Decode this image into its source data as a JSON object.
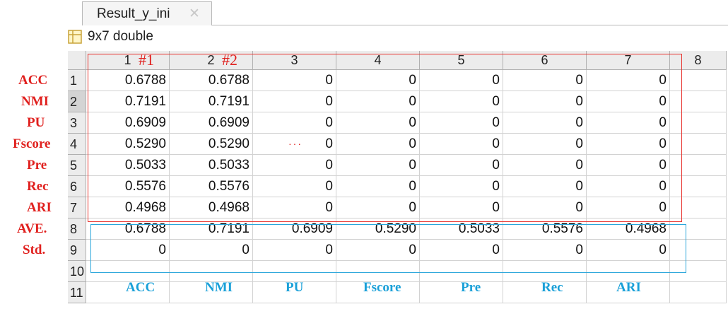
{
  "tab": {
    "label": "Result_y_ini",
    "close_glyph": "✕"
  },
  "variable_info": {
    "icon": "grid-icon",
    "text": "9x7 double"
  },
  "columns": [
    "1",
    "2",
    "3",
    "4",
    "5",
    "6",
    "7",
    "8"
  ],
  "rows": [
    {
      "num": "1",
      "values": [
        "0.6788",
        "0.6788",
        "0",
        "0",
        "0",
        "0",
        "0",
        ""
      ]
    },
    {
      "num": "2",
      "values": [
        "0.7191",
        "0.7191",
        "0",
        "0",
        "0",
        "0",
        "0",
        ""
      ]
    },
    {
      "num": "3",
      "values": [
        "0.6909",
        "0.6909",
        "0",
        "0",
        "0",
        "0",
        "0",
        ""
      ]
    },
    {
      "num": "4",
      "values": [
        "0.5290",
        "0.5290",
        "0",
        "0",
        "0",
        "0",
        "0",
        ""
      ]
    },
    {
      "num": "5",
      "values": [
        "0.5033",
        "0.5033",
        "0",
        "0",
        "0",
        "0",
        "0",
        ""
      ]
    },
    {
      "num": "6",
      "values": [
        "0.5576",
        "0.5576",
        "0",
        "0",
        "0",
        "0",
        "0",
        ""
      ]
    },
    {
      "num": "7",
      "values": [
        "0.4968",
        "0.4968",
        "0",
        "0",
        "0",
        "0",
        "0",
        ""
      ]
    },
    {
      "num": "8",
      "values": [
        "0.6788",
        "0.7191",
        "0.6909",
        "0.5290",
        "0.5033",
        "0.5576",
        "0.4968",
        ""
      ]
    },
    {
      "num": "9",
      "values": [
        "0",
        "0",
        "0",
        "0",
        "0",
        "0",
        "0",
        ""
      ]
    },
    {
      "num": "10",
      "values": [
        "",
        "",
        "",
        "",
        "",
        "",
        "",
        ""
      ]
    },
    {
      "num": "11",
      "values": [
        "",
        "",
        "",
        "",
        "",
        "",
        "",
        ""
      ]
    }
  ],
  "selected_row": "2",
  "row_annotations": [
    "ACC",
    "NMI",
    "PU",
    "Fscore",
    "Pre",
    "Rec",
    "ARI",
    "AVE.",
    "Std."
  ],
  "column_annotations": [
    "#1",
    "#2"
  ],
  "bottom_annotations": [
    "ACC",
    "NMI",
    "PU",
    "Fscore",
    "Pre",
    "Rec",
    "ARI"
  ],
  "dots": "···",
  "colors": {
    "annotation_red": "#e0201e",
    "annotation_blue": "#1aa0d8",
    "header_bg": "#ececec"
  }
}
